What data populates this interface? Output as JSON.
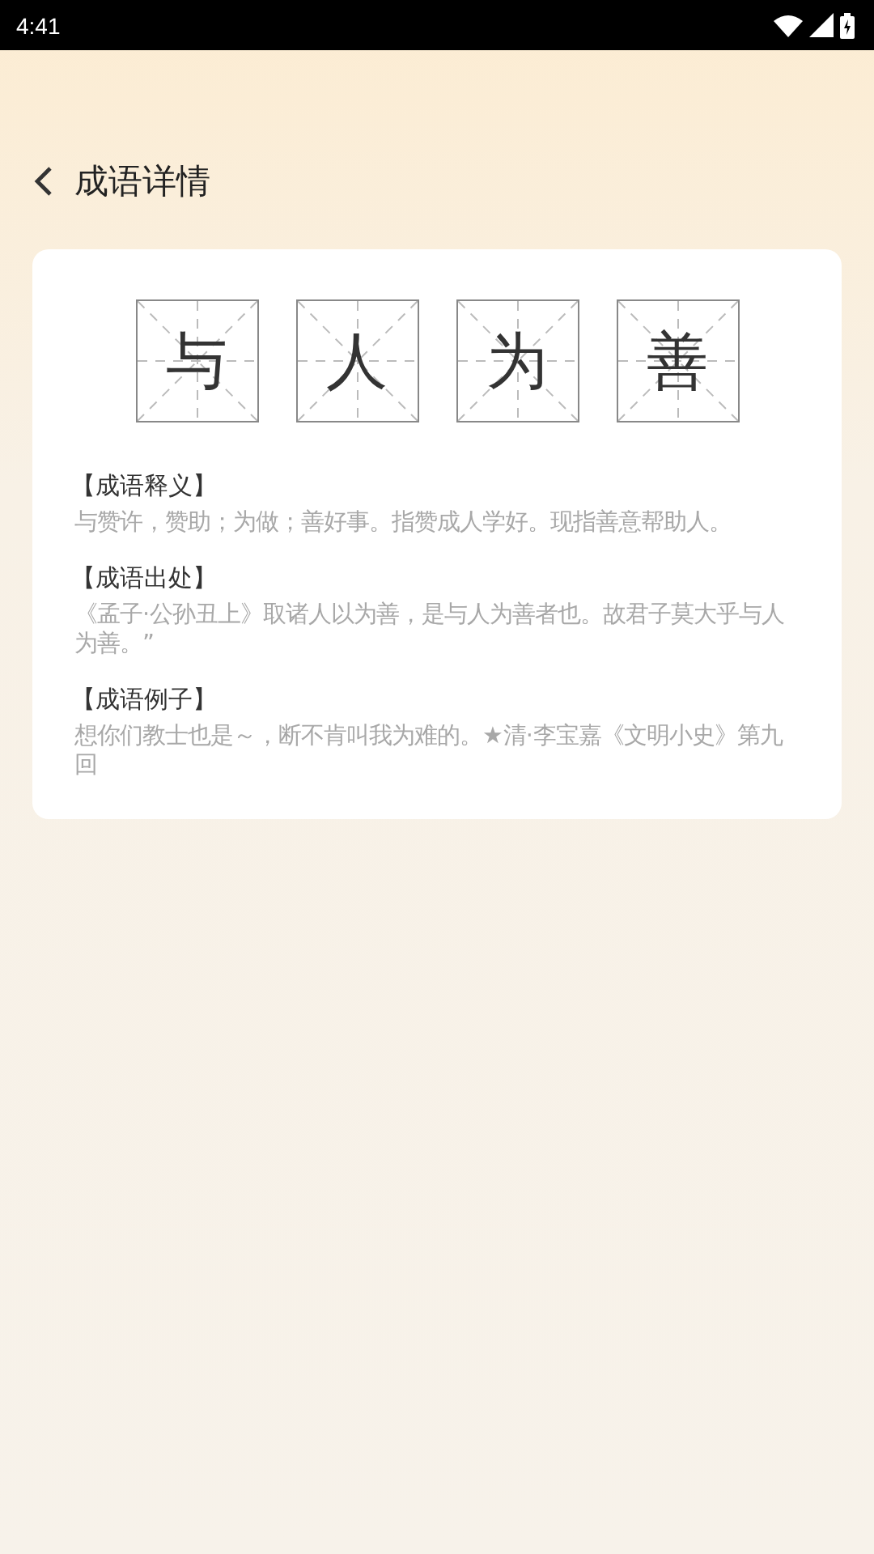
{
  "status_bar": {
    "time": "4:41"
  },
  "header": {
    "title": "成语详情"
  },
  "idiom": {
    "characters": [
      "与",
      "人",
      "为",
      "善"
    ]
  },
  "sections": [
    {
      "heading": "【成语释义】",
      "text": "与赞许，赞助；为做；善好事。指赞成人学好。现指善意帮助人。"
    },
    {
      "heading": "【成语出处】",
      "text": "《孟子·公孙丑上》取诸人以为善，是与人为善者也。故君子莫大乎与人为善。”"
    },
    {
      "heading": "【成语例子】",
      "text": "想你们教士也是～，断不肯叫我为难的。★清·李宝嘉《文明小史》第九回"
    }
  ]
}
